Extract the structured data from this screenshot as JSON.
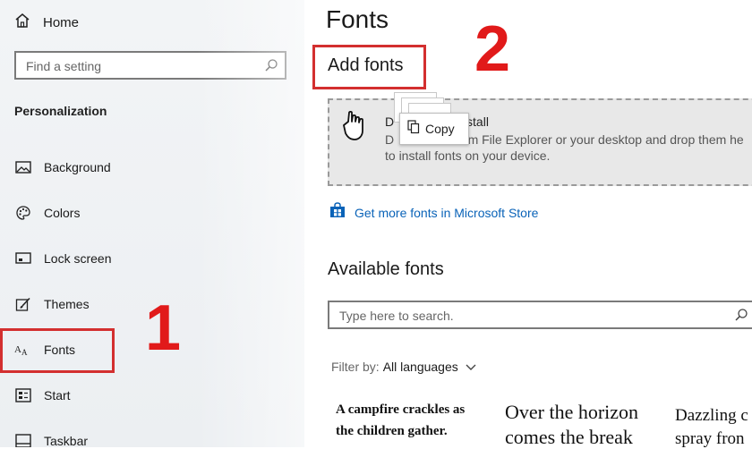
{
  "sidebar": {
    "home_label": "Home",
    "search_placeholder": "Find a setting",
    "section_title": "Personalization",
    "items": [
      {
        "label": "Background",
        "icon": "picture-icon"
      },
      {
        "label": "Colors",
        "icon": "palette-icon"
      },
      {
        "label": "Lock screen",
        "icon": "lock-screen-icon"
      },
      {
        "label": "Themes",
        "icon": "brush-icon"
      },
      {
        "label": "Fonts",
        "icon": "font-icon",
        "selected": true
      },
      {
        "label": "Start",
        "icon": "start-icon"
      },
      {
        "label": "Taskbar",
        "icon": "taskbar-icon"
      }
    ]
  },
  "annotations": {
    "step1": "1",
    "step2": "2",
    "highlight_color": "#d32f2f"
  },
  "main": {
    "page_title": "Fonts",
    "add_fonts_title": "Add fonts",
    "drop_heading": "D              to install",
    "drop_line1": "D                  rom File Explorer or your desktop and drop them he",
    "drop_line2": "to install fonts on your device.",
    "copy_tooltip": "Copy",
    "store_link": "Get more fonts in Microsoft Store",
    "available_title": "Available fonts",
    "font_search_placeholder": "Type here to search.",
    "filter_label": "Filter by:",
    "filter_value": "All languages",
    "previews": [
      {
        "line1": "A campfire crackles as",
        "line2": "the children gather."
      },
      {
        "line1": "Over the horizon",
        "line2": "comes the break"
      },
      {
        "line1": "Dazzling c",
        "line2": "spray fron"
      }
    ]
  },
  "colors": {
    "link": "#0a63b8",
    "annotation_red": "#e11a1a"
  }
}
